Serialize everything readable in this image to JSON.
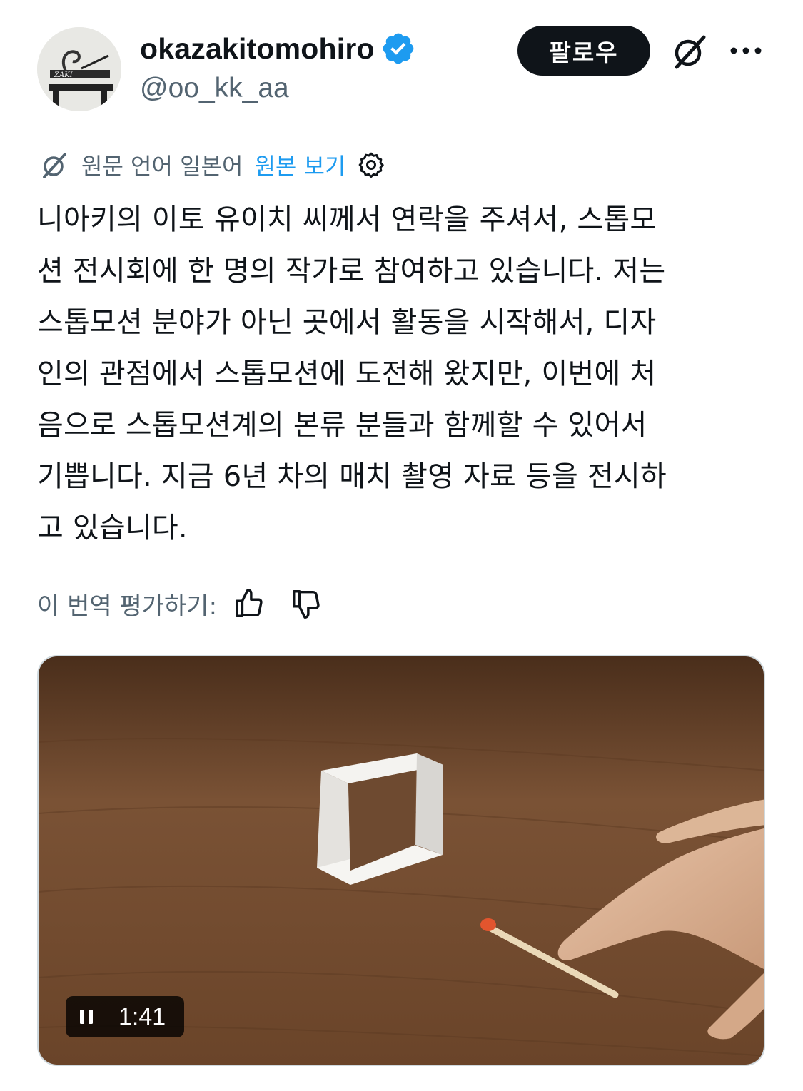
{
  "header": {
    "display_name": "okazakitomohiro",
    "handle": "@oo_kk_aa",
    "follow_label": "팔로우",
    "verified": true,
    "icons": {
      "avatar": "avatar",
      "verified": "verified-badge-icon",
      "grok": "grok-icon",
      "more": "more-options-icon"
    }
  },
  "translation": {
    "source_language": "원문 언어 일본어",
    "view_original": "원본 보기"
  },
  "tweet": {
    "lines": [
      "니아키의 이토 유이치 씨께서 연락을 주셔서, 스톱모",
      "션 전시회에 한 명의 작가로 참여하고 있습니다. 저는",
      "스톱모션 분야가 아닌 곳에서 활동을 시작해서, 디자",
      "인의 관점에서 스톱모션에 도전해 왔지만, 이번에 처",
      "음으로 스톱모션계의 본류 분들과 함께할 수 있어서",
      "기쁩니다. 지금 6년 차의 매치 촬영 자료 등을 전시하",
      "고 있습니다."
    ]
  },
  "rating": {
    "label": "이 번역 평가하기:",
    "icons": [
      "thumbs-up-icon",
      "thumbs-down-icon"
    ]
  },
  "video": {
    "duration": "1:41",
    "state_icon": "pause-icon"
  },
  "colors": {
    "text": "#0f1419",
    "secondary": "#536471",
    "link": "#1d9bf0",
    "verified": "#1d9bf0",
    "button_bg": "#0f1419",
    "button_text": "#ffffff"
  }
}
